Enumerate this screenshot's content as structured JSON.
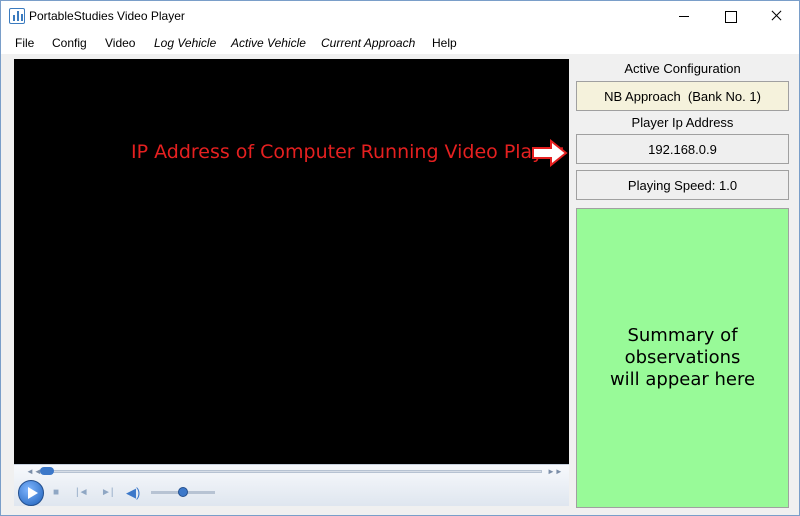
{
  "window": {
    "title": "PortableStudies Video Player"
  },
  "menu": {
    "items": [
      {
        "label": "File"
      },
      {
        "label": "Config"
      },
      {
        "label": "Video"
      },
      {
        "label": "Log Vehicle"
      },
      {
        "label": "Active Vehicle"
      },
      {
        "label": "Current Approach"
      },
      {
        "label": "Help"
      }
    ]
  },
  "annotation": {
    "text": "IP Address of Computer Running Video Player",
    "color": "#e52020"
  },
  "panel": {
    "active_config_label": "Active Configuration",
    "approach_value": "NB Approach  (Bank No. 1)",
    "player_ip_label": "Player Ip Address",
    "ip_value": "192.168.0.9",
    "playing_speed": "Playing Speed: 1.0",
    "summary_text": "Summary of observations will appear here",
    "summary_color": "#98fa98"
  },
  "player": {
    "seek_position": 0.0,
    "volume_level": 0.5
  }
}
